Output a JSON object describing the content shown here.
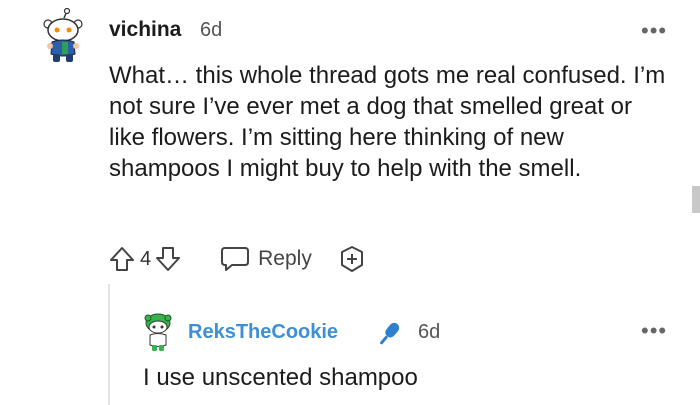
{
  "comment": {
    "author": "vichina",
    "time": "6d",
    "more": "•••",
    "body": "What… this whole thread gots me real confused. I’m not sure I’ve ever met a dog that smelled great or like flowers. I’m sitting here thinking of new shampoos I might buy to help with the smell.",
    "votes": "4",
    "reply_label": "Reply"
  },
  "reply": {
    "author": "ReksTheCookie",
    "time": "6d",
    "more": "•••",
    "body": "I use unscented shampoo",
    "author_color": "#3d8fd6"
  },
  "icons": {
    "upvote": "arrow-up-icon",
    "downvote": "arrow-down-icon",
    "reply": "speech-bubble-icon",
    "award": "award-plus-icon",
    "mic": "microphone-icon"
  }
}
